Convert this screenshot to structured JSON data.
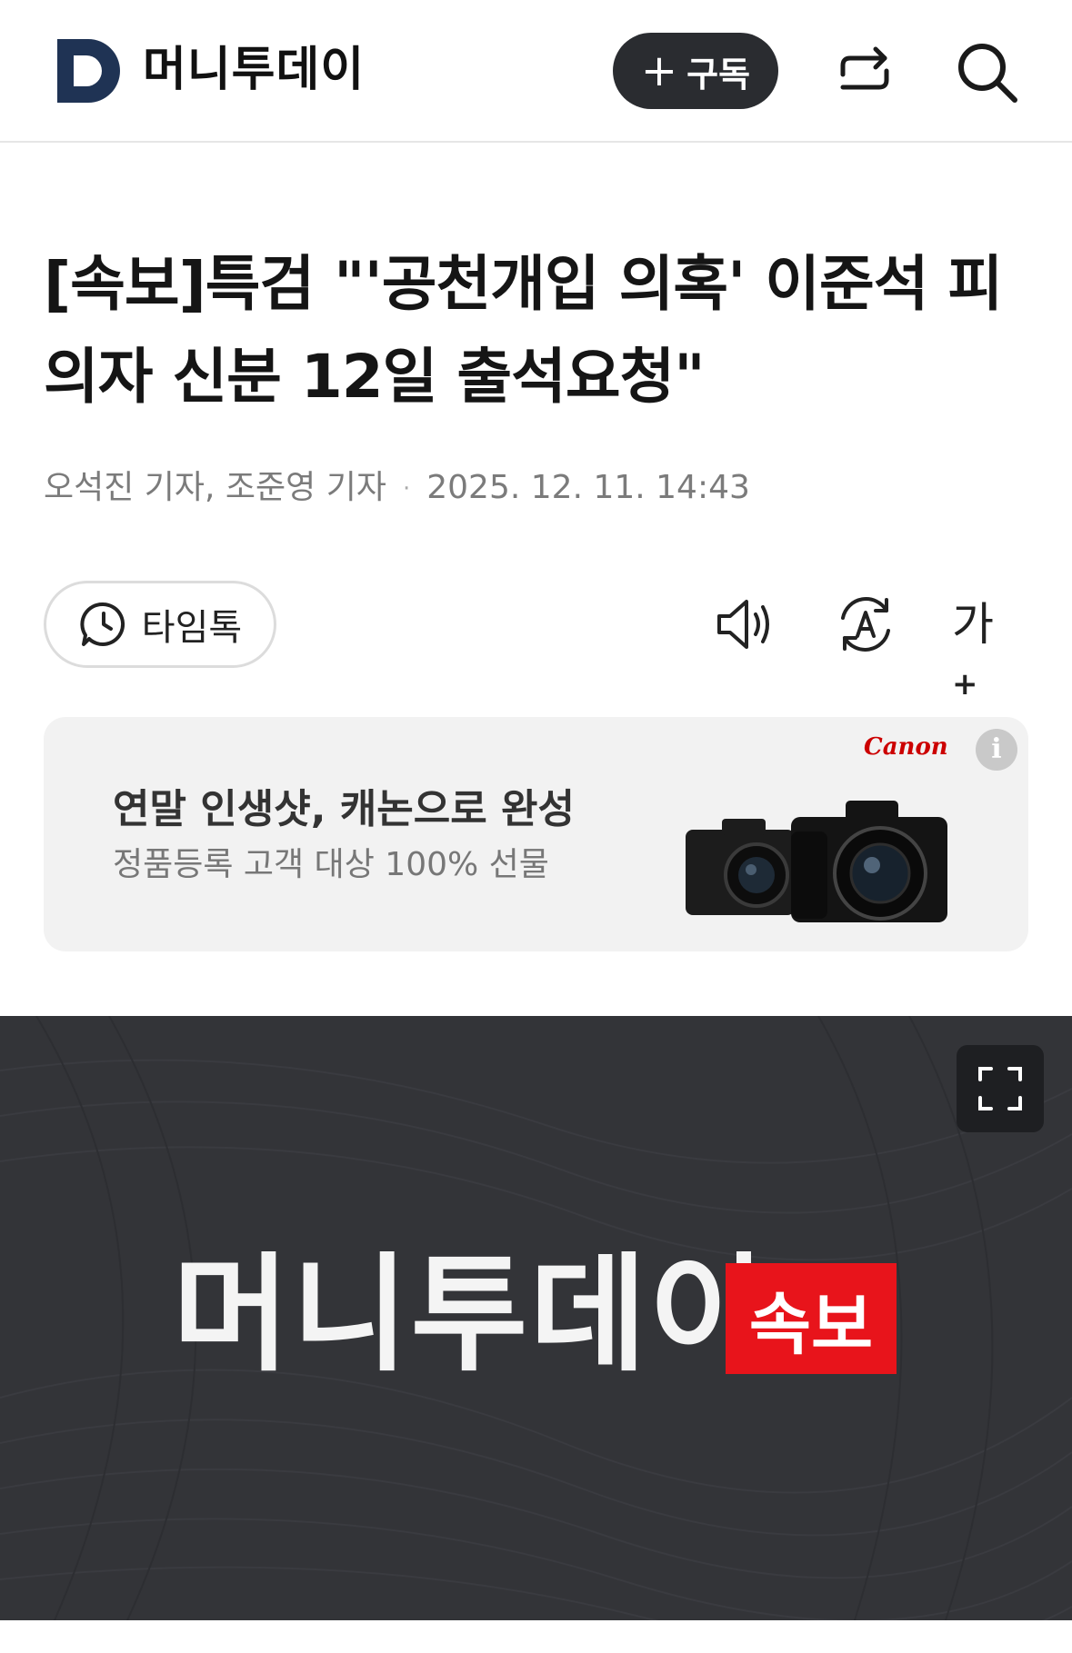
{
  "header": {
    "logo_letter": "D",
    "brand": "머니투데이",
    "subscribe_plus": "+",
    "subscribe_label": "구독"
  },
  "article": {
    "headline": "[속보]특검 \"'공천개입 의혹' 이준석 피의자 신분 12일 출석요청\"",
    "byline": "오석진 기자, 조준영 기자",
    "byline_sep": "·",
    "timestamp": "2025. 12. 11. 14:43"
  },
  "toolbar": {
    "talk_label": "타임톡",
    "fontsize_label": "가",
    "fontsize_sup": "+"
  },
  "ad": {
    "brand": "Canon",
    "title": "연말 인생샷, 캐논으로 완성",
    "subtitle": "정품등록 고객 대상 100% 선물",
    "info": "i"
  },
  "hero": {
    "logo_text": "머니투데이",
    "badge": "속보"
  },
  "colors": {
    "subscribe_bg": "#2a2c30",
    "logo_navy": "#1f3354",
    "breaking_red": "#e8141b",
    "canon_red": "#cc0000",
    "hero_bg": "#333438"
  }
}
